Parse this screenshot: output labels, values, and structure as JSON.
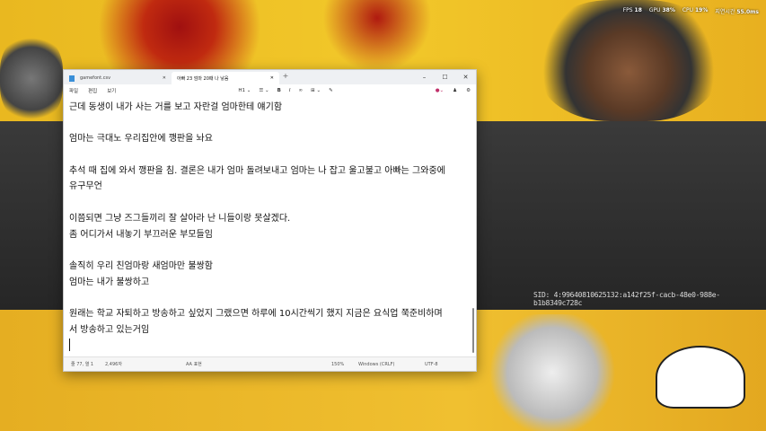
{
  "overlay": {
    "fps_label": "FPS",
    "fps": "18",
    "gpu_label": "GPU",
    "gpu": "38%",
    "cpu_label": "CPU",
    "cpu": "19%",
    "latency_label": "지연시간",
    "latency": "55.0ms"
  },
  "sid": "SID: 4:99640810625132:a142f25f-cacb-48e0-988e-b1b8349c728c",
  "notepad": {
    "tabs": [
      {
        "label": "gamefont.csv"
      },
      {
        "label": "아빠 23 엄마 20때 나 낳음"
      }
    ],
    "new_tab": "+",
    "window_buttons": {
      "minimize": "–",
      "maximize": "☐",
      "close": "✕"
    },
    "menu": [
      "파일",
      "편집",
      "보기"
    ],
    "toolbar": {
      "heading": "H1 ⌄",
      "list": "☰ ⌄",
      "bold": "B",
      "italic": "I",
      "link": "∞",
      "table": "⊞ ⌄",
      "clear": "✎"
    },
    "lines": [
      "근데 동생이 내가 사는 거를 보고 자란걸 엄마한테 얘기함",
      "",
      "엄마는 극대노 우리집안에 깽판을 놔요",
      "",
      "추석 때 집에 와서 깽판을 침. 결론은 내가 엄마 돌려보내고 엄마는 나 잡고 울고불고 아빠는 그와중에",
      "유구무언",
      "",
      "이쯤되면 그냥 즈그들끼리 잘 살아라 난 니들이랑 못살겠다.",
      "좀 어디가서 내놓기 부끄러운 부모들임",
      "",
      "솔직히 우리 친엄마랑 새엄마만 불쌍함",
      "엄마는 내가 불쌍하고",
      "",
      "원래는 학교 자퇴하고 방송하고 싶었지 그랬으면 하루에 10시간씩기 했지 지금은 요식업 쭉준비하며",
      "서 방송하고 있는거임"
    ],
    "status": {
      "position": "줄 77, 열 1",
      "chars": "2,496자",
      "spell": "AA 표현",
      "zoom": "150%",
      "line_ending": "Windows (CRLF)",
      "encoding": "UTF-8"
    }
  }
}
